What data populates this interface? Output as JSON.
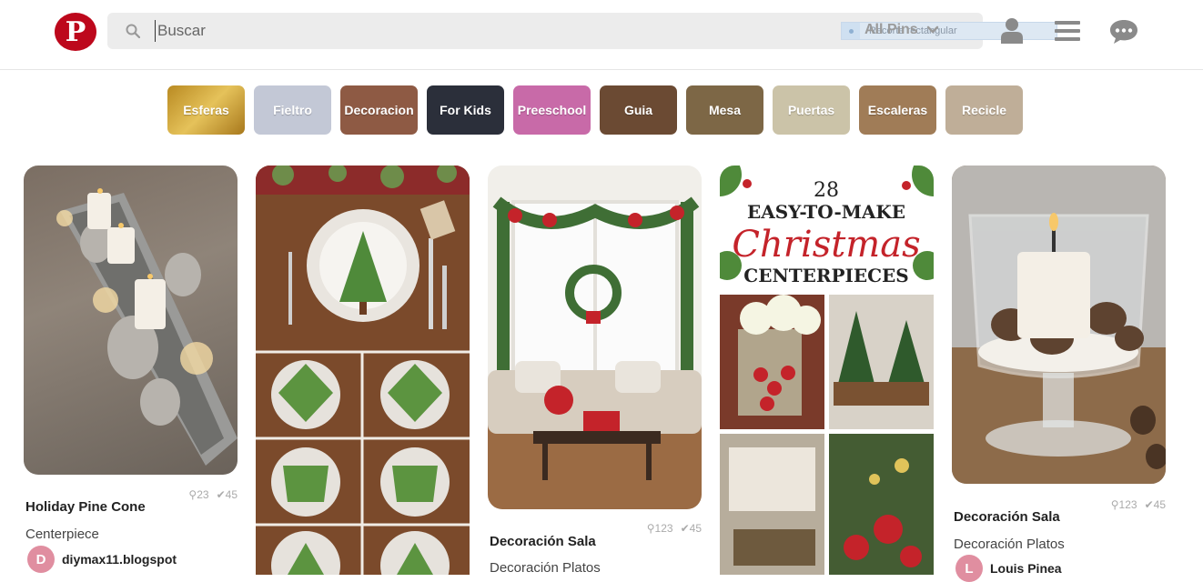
{
  "header": {
    "logo_letter": "P",
    "search_placeholder": "Buscar",
    "scope_label": "All Pins",
    "tooltip_label": "Recorte rectangular"
  },
  "categories": [
    {
      "label": "Esferas",
      "color": "#c9a13a"
    },
    {
      "label": "Fieltro",
      "color": "#c3c8d6"
    },
    {
      "label": "Decoracion",
      "color": "#8e5a44"
    },
    {
      "label": "For Kids",
      "color": "#2b2f3a"
    },
    {
      "label": "Preeschool",
      "color": "#c86aa8"
    },
    {
      "label": "Guia",
      "color": "#6b4a33"
    },
    {
      "label": "Mesa",
      "color": "#7d6746"
    },
    {
      "label": "Puertas",
      "color": "#cbc3a8"
    },
    {
      "label": "Escaleras",
      "color": "#a07c57"
    },
    {
      "label": "Recicle",
      "color": "#bfae98"
    }
  ],
  "pins": [
    {
      "title": "Holiday Pine Cone",
      "description": "Centerpiece",
      "repins": "23",
      "likes": "45",
      "user": "diymax11.blogspot",
      "avatar_letter": "D"
    },
    {
      "title": "",
      "description": "",
      "repins": "",
      "likes": "",
      "user": "",
      "avatar_letter": ""
    },
    {
      "title": "Decoración Sala",
      "description": "Decoración Platos",
      "repins": "123",
      "likes": "45",
      "user": "",
      "avatar_letter": ""
    },
    {
      "title": "",
      "description": "",
      "repins": "",
      "likes": "",
      "user": "",
      "avatar_letter": "",
      "overlay": {
        "number": "28",
        "line1": "EASY-TO-MAKE",
        "line2": "Christmas",
        "line3": "CENTERPIECES"
      }
    },
    {
      "title": "Decoración Sala",
      "description": "Decoración Platos",
      "repins": "123",
      "likes": "45",
      "user": "Louis Pinea",
      "avatar_letter": "L"
    }
  ]
}
